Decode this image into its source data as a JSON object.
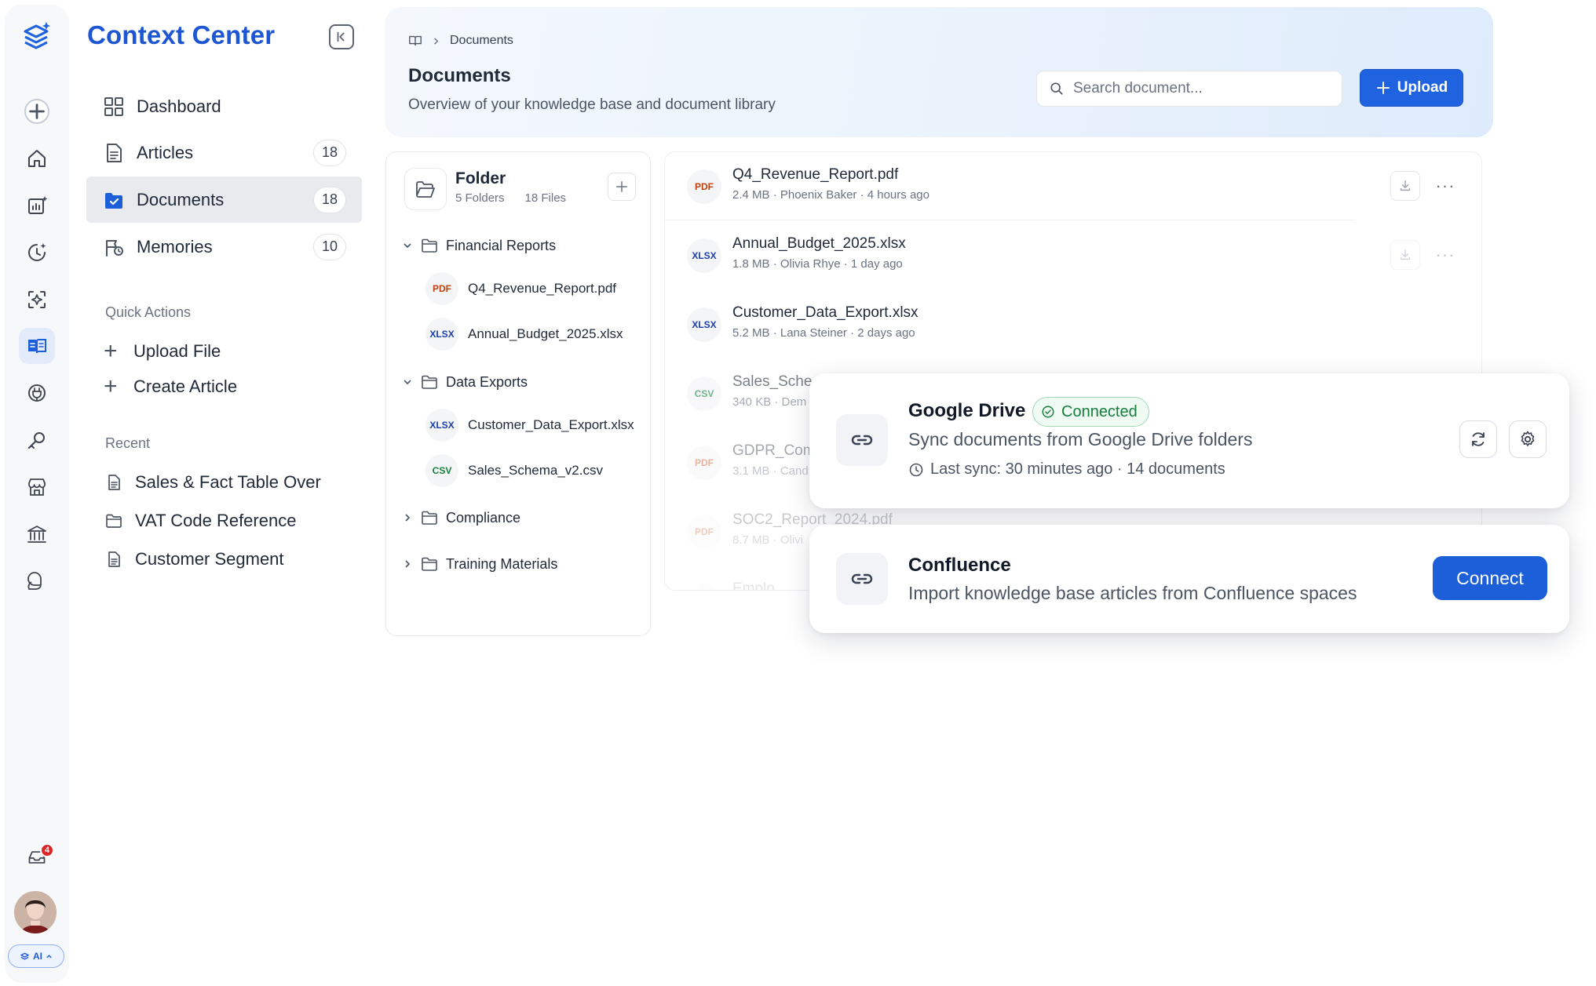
{
  "app": {
    "title": "Context Center",
    "notification_count": "4",
    "ai_chip_label": "AI"
  },
  "colors": {
    "accent": "#1f63e0",
    "title_blue": "#1d56d2",
    "connected_green": "#15803d",
    "badge_red": "#dc2626"
  },
  "rail": {
    "items": [
      "new-icon",
      "home-icon",
      "analytics-icon",
      "history-icon",
      "ai-scan-icon",
      "context-icon",
      "plugin-icon",
      "tools-icon",
      "store-icon",
      "bank-icon",
      "support-icon",
      "inbox-icon"
    ],
    "active": "context-icon"
  },
  "sidebar": {
    "nav": [
      {
        "label": "Dashboard",
        "count": ""
      },
      {
        "label": "Articles",
        "count": "18"
      },
      {
        "label": "Documents",
        "count": "18"
      },
      {
        "label": "Memories",
        "count": "10"
      }
    ],
    "quick_actions_label": "Quick Actions",
    "quick_actions": [
      "Upload File",
      "Create Article"
    ],
    "recent_label": "Recent",
    "recent": [
      "Sales & Fact Table Over",
      "VAT Code Reference",
      "Customer Segment"
    ]
  },
  "header": {
    "breadcrumb": "Documents",
    "title": "Documents",
    "subtitle": "Overview of your knowledge base and document library",
    "search_placeholder": "Search document...",
    "upload_label": "Upload"
  },
  "folders": {
    "title": "Folder",
    "folders_count": "5 Folders",
    "files_count": "18 Files",
    "groups": [
      {
        "name": "Financial Reports",
        "expanded": true,
        "files": [
          {
            "type": "PDF",
            "name": "Q4_Revenue_Report.pdf"
          },
          {
            "type": "XLSX",
            "name": "Annual_Budget_2025.xlsx"
          }
        ]
      },
      {
        "name": "Data Exports",
        "expanded": true,
        "files": [
          {
            "type": "XLSX",
            "name": "Customer_Data_Export.xlsx"
          },
          {
            "type": "CSV",
            "name": "Sales_Schema_v2.csv"
          }
        ]
      },
      {
        "name": "Compliance",
        "expanded": false,
        "files": []
      },
      {
        "name": "Training Materials",
        "expanded": false,
        "files": []
      }
    ]
  },
  "documents": [
    {
      "type": "PDF",
      "name": "Q4_Revenue_Report.pdf",
      "meta": "2.4 MB · Phoenix Baker · 4 hours ago"
    },
    {
      "type": "XLSX",
      "name": "Annual_Budget_2025.xlsx",
      "meta": "1.8 MB · Olivia Rhye · 1 day ago"
    },
    {
      "type": "XLSX",
      "name": "Customer_Data_Export.xlsx",
      "meta": "5.2 MB · Lana Steiner · 2 days ago"
    },
    {
      "type": "CSV",
      "name": "Sales_Sche",
      "meta": "340 KB · Dem"
    },
    {
      "type": "PDF",
      "name": "GDPR_Com",
      "meta": "3.1 MB · Cand"
    },
    {
      "type": "PDF",
      "name": "SOC2_Report_2024.pdf",
      "meta": "8.7 MB · Olivi"
    },
    {
      "type": "XLSX",
      "name": "Emplo",
      "meta": ""
    }
  ],
  "integrations": {
    "google_drive": {
      "name": "Google Drive",
      "status": "Connected",
      "description": "Sync documents from Google Drive folders",
      "sync": "Last sync: 30 minutes ago · 14 documents"
    },
    "confluence": {
      "name": "Confluence",
      "description": "Import knowledge base articles from Confluence spaces",
      "action": "Connect"
    }
  }
}
